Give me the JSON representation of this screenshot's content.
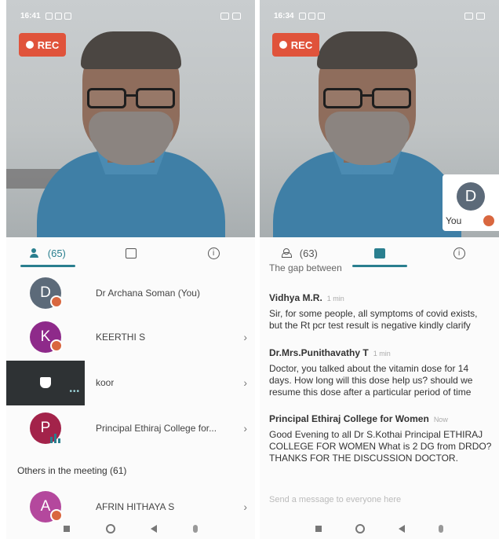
{
  "left": {
    "status_time": "16:41",
    "rec_label": "REC",
    "tabs": {
      "participants": "(65)"
    },
    "participants": [
      {
        "initial": "D",
        "name": "Dr  Archana Soman (You)",
        "color": "#5c6a79"
      },
      {
        "initial": "K",
        "name": "KEERTHI S",
        "color": "#8e2a8a"
      },
      {
        "initial": "",
        "name": "koor",
        "color": "#2e3234"
      },
      {
        "initial": "P",
        "name": "Principal Ethiraj College for...",
        "color": "#a3234a"
      }
    ],
    "others_header": "Others in the meeting (61)",
    "others": [
      {
        "initial": "A",
        "name": "AFRIN HITHAYA S",
        "color": "#b4489d"
      }
    ],
    "chevron": "›"
  },
  "right": {
    "status_time": "16:34",
    "rec_label": "REC",
    "self_tile": {
      "initial": "D",
      "label": "You"
    },
    "tabs": {
      "participants": "(63)"
    },
    "cut_text": "The gap  between",
    "messages": [
      {
        "sender": "Vidhya M.R.",
        "time": "1 min",
        "body": "Sir, for some people, all symptoms of covid exists, but the Rt pcr test result is negative kindly clarify"
      },
      {
        "sender": "Dr.Mrs.Punithavathy T",
        "time": "1 min",
        "body": "Doctor, you talked about the vitamin dose for 14 days. How long will this dose help us? should we resume  this dose after a particular period of time"
      },
      {
        "sender": "Principal Ethiraj College for Women",
        "time": "Now",
        "body": "Good Evening  to all  Dr S.Kothai  Principal ETHIRAJ COLLEGE FOR WOMEN  What is 2 DG from DRDO? THANKS  FOR THE  DISCUSSION DOCTOR."
      }
    ],
    "composer_placeholder": "Send a message to everyone here"
  },
  "colors": {
    "accent": "#2a7f8f",
    "rec": "#e0533b",
    "mute": "#d9673f"
  },
  "icons": [
    "people-icon",
    "chat-icon",
    "info-icon",
    "mute-icon",
    "pin-icon",
    "audio-bars-icon",
    "chevron-right-icon"
  ]
}
